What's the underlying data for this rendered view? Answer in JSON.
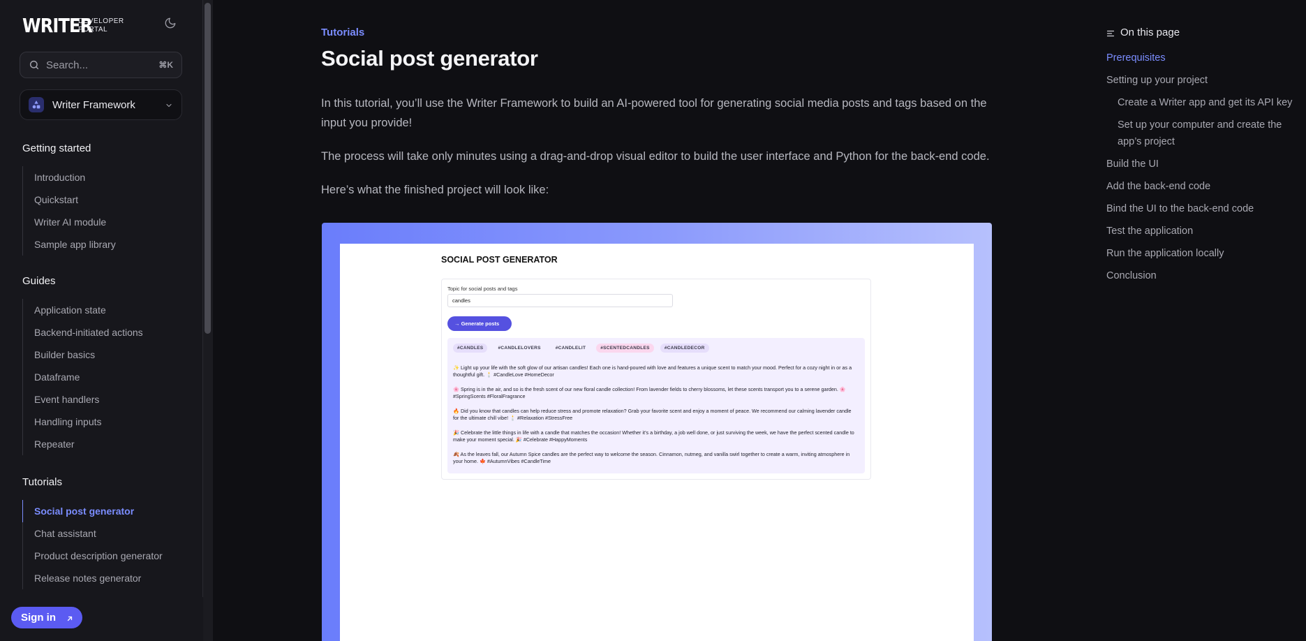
{
  "brand": {
    "logo_word": "WRITER",
    "logo_sub_1": "DEVELOPER",
    "logo_sub_2": "PORTAL"
  },
  "search": {
    "placeholder": "Search...",
    "shortcut": "⌘K"
  },
  "product_selector": {
    "label": "Writer Framework"
  },
  "nav": {
    "getting_started": {
      "title": "Getting started",
      "items": [
        "Introduction",
        "Quickstart",
        "Writer AI module",
        "Sample app library"
      ]
    },
    "guides": {
      "title": "Guides",
      "items": [
        "Application state",
        "Backend-initiated actions",
        "Builder basics",
        "Dataframe",
        "Event handlers",
        "Handling inputs",
        "Repeater"
      ]
    },
    "tutorials": {
      "title": "Tutorials",
      "items": [
        "Social post generator",
        "Chat assistant",
        "Product description generator",
        "Release notes generator"
      ],
      "active_index": 0
    }
  },
  "signin": {
    "label": "Sign in"
  },
  "article": {
    "eyebrow": "Tutorials",
    "title": "Social post generator",
    "para1": "In this tutorial, you’ll use the Writer Framework to build an AI-powered tool for generating social media posts and tags based on the input you provide!",
    "para2": "The process will take only minutes using a drag-and-drop visual editor to build the user interface and Python for the back-end code.",
    "para3": "Here’s what the finished project will look like:"
  },
  "preview": {
    "app_title": "SOCIAL POST GENERATOR",
    "input_label": "Topic for social posts and tags",
    "input_value": "candles",
    "button_label": "→  Generate posts",
    "tags": [
      {
        "text": "#CANDLES",
        "color": "#e6defb"
      },
      {
        "text": "#CANDLELOVERS",
        "color": "#f3efff"
      },
      {
        "text": "#CANDLELIT",
        "color": "#f3efff"
      },
      {
        "text": "#SCENTEDCANDLES",
        "color": "#fbd7ee"
      },
      {
        "text": "#CANDLEDECOR",
        "color": "#e6defb"
      }
    ],
    "posts": [
      "✨ Light up your life with the soft glow of our artisan candles! Each one is hand-poured with love and features a unique scent to match your mood. Perfect for a cozy night in or as a thoughtful gift. 🕯️ #CandleLove #HomeDecor",
      "🌸 Spring is in the air, and so is the fresh scent of our new floral candle collection! From lavender fields to cherry blossoms, let these scents transport you to a serene garden. 🌸 #SpringScents #FloralFragrance",
      "🔥 Did you know that candles can help reduce stress and promote relaxation? Grab your favorite scent and enjoy a moment of peace. We recommend our calming lavender candle for the ultimate chill vibe! 🕯️ #Relaxation #StressFree",
      "🎉 Celebrate the little things in life with a candle that matches the occasion! Whether it’s a birthday, a job well done, or just surviving the week, we have the perfect scented candle to make your moment special. 🎉 #Celebrate #HappyMoments",
      "🍂 As the leaves fall, our Autumn Spice candles are the perfect way to welcome the season. Cinnamon, nutmeg, and vanilla swirl together to create a warm, inviting atmosphere in your home. 🍁 #AutumnVibes #CandleTime"
    ]
  },
  "toc": {
    "title": "On this page",
    "items": [
      {
        "label": "Prerequisites",
        "level": 1,
        "active": true
      },
      {
        "label": "Setting up your project",
        "level": 1
      },
      {
        "label": "Create a Writer app and get its API key",
        "level": 2
      },
      {
        "label": "Set up your computer and create the",
        "level": 2
      },
      {
        "label": "app’s project",
        "level": 2
      },
      {
        "label": "Build the UI",
        "level": 1
      },
      {
        "label": "Add the back-end code",
        "level": 1
      },
      {
        "label": "Bind the UI to the back-end code",
        "level": 1
      },
      {
        "label": "Test the application",
        "level": 1
      },
      {
        "label": "Run the application locally",
        "level": 1
      },
      {
        "label": "Conclusion",
        "level": 1
      }
    ]
  },
  "colors": {
    "accent": "#7b8dff",
    "signin_bg": "#5b5bf2",
    "page_bg": "#0f0f13",
    "sidebar_bg": "#17171c"
  }
}
